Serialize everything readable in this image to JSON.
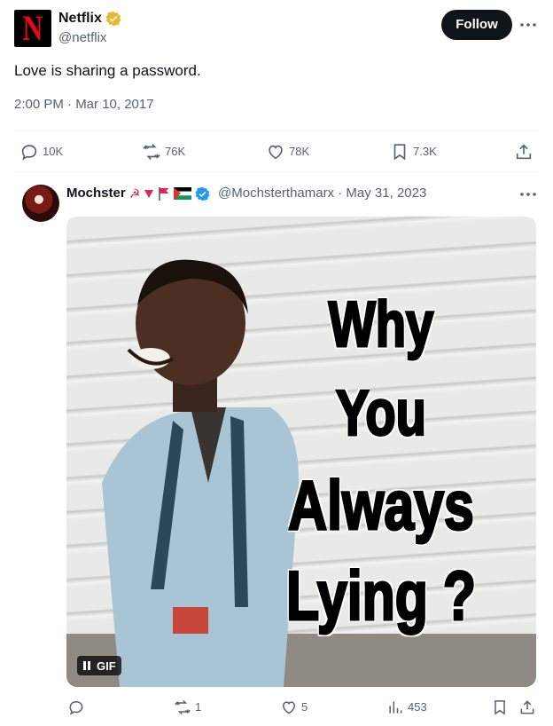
{
  "tweet": {
    "author_name": "Netflix",
    "author_handle": "@netflix",
    "logo_letter": "N",
    "follow_label": "Follow",
    "text": "Love is sharing a password.",
    "meta": "2:00 PM · Mar 10, 2017",
    "stats": {
      "replies": "10K",
      "retweets": "76K",
      "likes": "78K",
      "bookmarks": "7.3K"
    }
  },
  "reply": {
    "author_name": "Mochster",
    "name_emoji": "☭",
    "handle_date": "@Mochsterthamarx · May 31, 2023",
    "media_caption": [
      "Why",
      "You",
      "Always",
      "Lying ?"
    ],
    "media_badge": "GIF",
    "stats": {
      "replies": "",
      "retweets": "1",
      "likes": "5",
      "views": "453"
    }
  },
  "colors": {
    "verified_gold": "#e8b92e",
    "verified_blue": "#1d9bf0",
    "netflix_red": "#e50914",
    "text_gray": "#536471"
  }
}
